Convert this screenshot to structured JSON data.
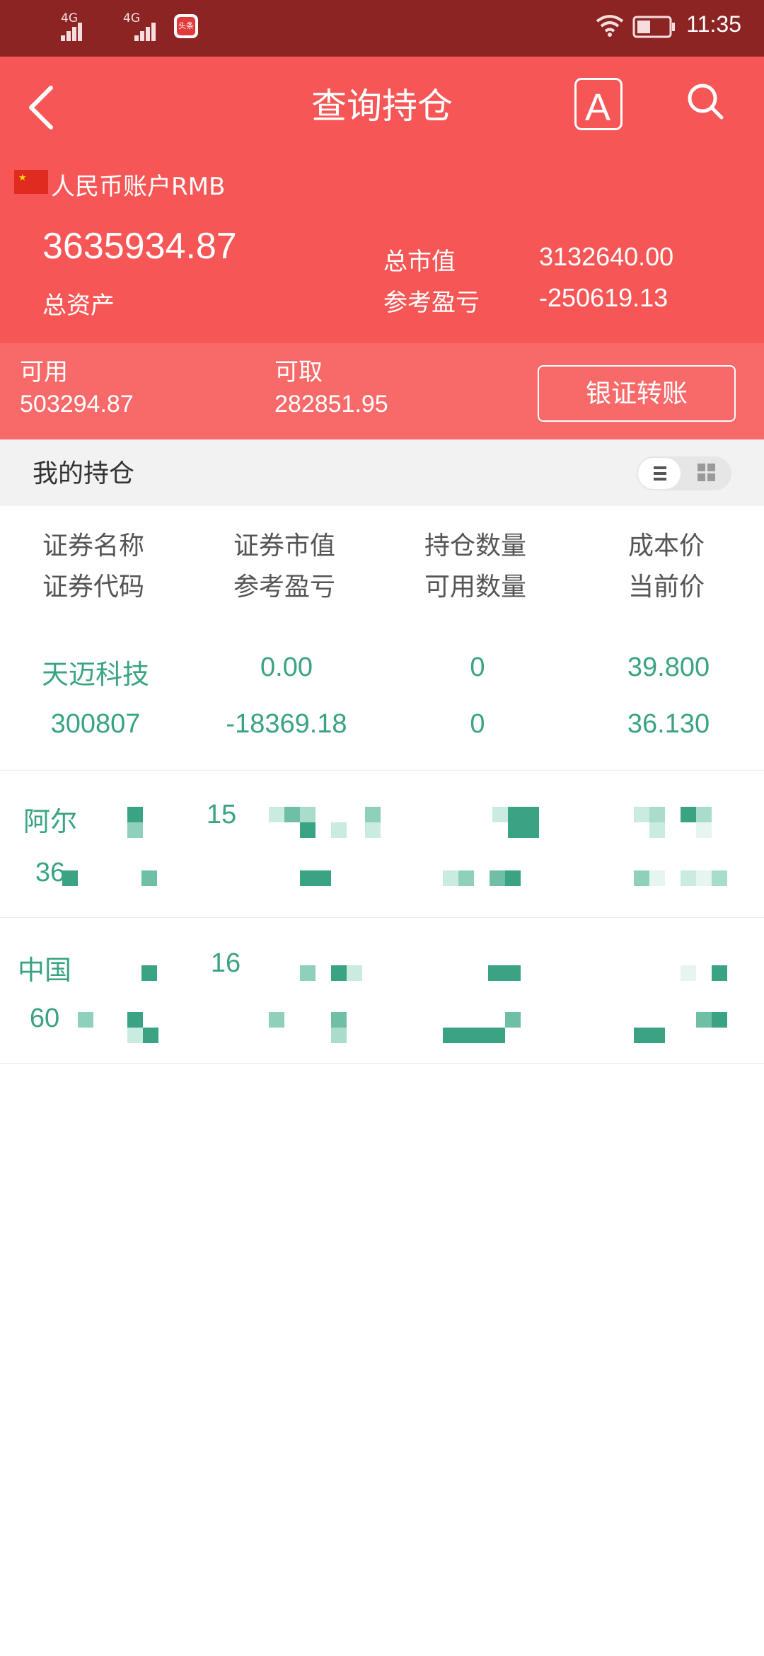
{
  "status_bar": {
    "network1": "4G",
    "network2": "4G",
    "app_badge": "头条",
    "time": "11:35"
  },
  "header": {
    "title": "查询持仓",
    "font_button": "A",
    "account_label": "人民币账户RMB",
    "total_assets_value": "3635934.87",
    "total_assets_label": "总资产",
    "market_value_label": "总市值",
    "market_value": "3132640.00",
    "pnl_label": "参考盈亏",
    "pnl_value": "-250619.13"
  },
  "available": {
    "usable_label": "可用",
    "usable_value": "503294.87",
    "withdrawable_label": "可取",
    "withdrawable_value": "282851.95",
    "transfer_button": "银证转账"
  },
  "holdings": {
    "title": "我的持仓",
    "columns": [
      {
        "top": "证券名称",
        "bottom": "证券代码"
      },
      {
        "top": "证券市值",
        "bottom": "参考盈亏"
      },
      {
        "top": "持仓数量",
        "bottom": "可用数量"
      },
      {
        "top": "成本价",
        "bottom": "当前价"
      }
    ],
    "rows": [
      {
        "name": "天迈科技",
        "code": "300807",
        "market_value": "0.00",
        "pnl": "-18369.18",
        "qty": "0",
        "avail_qty": "0",
        "cost": "39.800",
        "price": "36.130"
      },
      {
        "name": "阿尔",
        "code": "36",
        "market_value": "15",
        "pnl": "",
        "qty": "",
        "avail_qty": "",
        "cost": "",
        "price": ""
      },
      {
        "name": "中国",
        "code": "60",
        "market_value": "16",
        "pnl": "",
        "qty": "",
        "avail_qty": "",
        "cost": "",
        "price": ""
      }
    ]
  },
  "colors": {
    "status_bar": "#8d2424",
    "header": "#f65656",
    "avail_strip": "#f86a6a",
    "row_text": "#3aa383"
  },
  "icons": [
    "back-arrow-icon",
    "font-size-icon",
    "search-icon",
    "china-flag-icon",
    "list-view-icon",
    "grid-view-icon",
    "wifi-icon",
    "battery-icon",
    "signal-icon"
  ]
}
